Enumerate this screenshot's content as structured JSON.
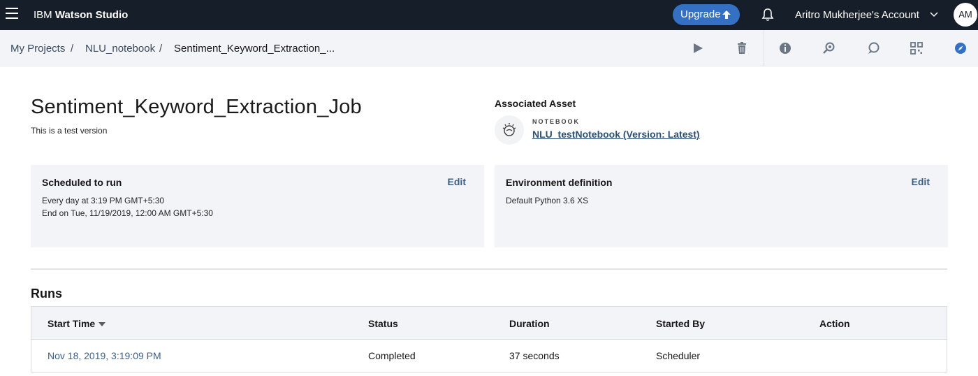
{
  "topbar": {
    "brand_regular": "IBM ",
    "brand_bold": "Watson Studio",
    "upgrade_label": "Upgrade",
    "account_label": "Aritro Mukherjee's Account",
    "avatar_initials": "AM"
  },
  "breadcrumb": {
    "items": [
      "My Projects",
      "NLU_notebook",
      "Sentiment_Keyword_Extraction_..."
    ],
    "separator": "/"
  },
  "toolbar": {
    "icons": [
      "run-icon",
      "delete-icon",
      "info-icon",
      "find-and-add-data-icon",
      "comments-icon",
      "grid-icon",
      "explore-icon"
    ]
  },
  "job": {
    "title": "Sentiment_Keyword_Extraction_Job",
    "description": "This is a test version"
  },
  "associated_asset": {
    "heading": "Associated Asset",
    "kind": "NOTEBOOK",
    "link": "NLU_testNotebook (Version: Latest)"
  },
  "schedule_card": {
    "title": "Scheduled to run",
    "edit": "Edit",
    "line1": "Every day at 3:19 PM GMT+5:30",
    "line2": "End on Tue, 11/19/2019, 12:00 AM GMT+5:30"
  },
  "environment_card": {
    "title": "Environment definition",
    "edit": "Edit",
    "line1": "Default Python 3.6 XS"
  },
  "runs": {
    "title": "Runs",
    "columns": [
      "Start Time",
      "Status",
      "Duration",
      "Started By",
      "Action"
    ],
    "rows": [
      {
        "start_time": "Nov 18, 2019, 3:19:09 PM",
        "status": "Completed",
        "duration": "37 seconds",
        "started_by": "Scheduler",
        "action": ""
      }
    ]
  },
  "colors": {
    "topbar_bg": "#161e29",
    "upgrade_bg": "#3470c4",
    "link": "#3d5f86",
    "card_bg": "#f3f4f7"
  }
}
